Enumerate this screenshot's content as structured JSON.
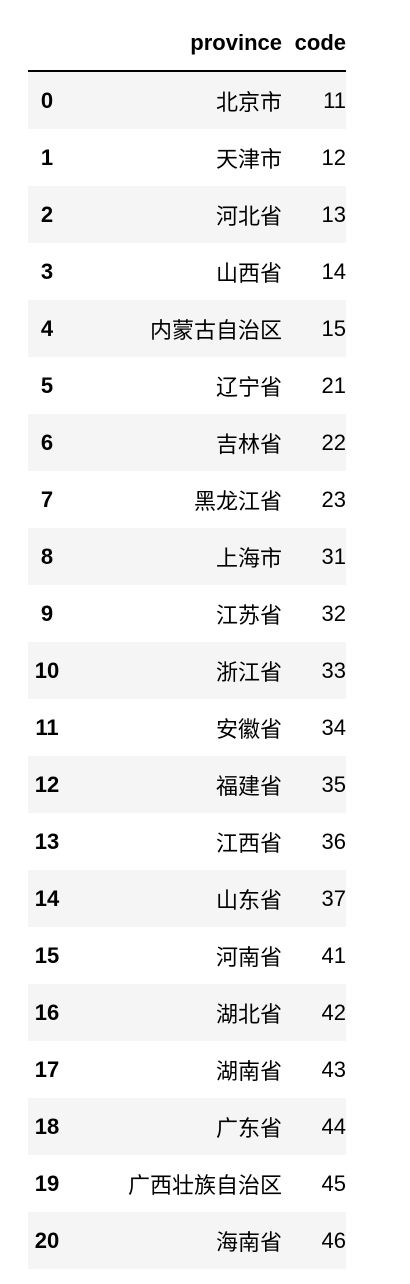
{
  "table": {
    "columns": {
      "index": "",
      "province": "province",
      "code": "code"
    },
    "rows": [
      {
        "index": "0",
        "province": "北京市",
        "code": "11"
      },
      {
        "index": "1",
        "province": "天津市",
        "code": "12"
      },
      {
        "index": "2",
        "province": "河北省",
        "code": "13"
      },
      {
        "index": "3",
        "province": "山西省",
        "code": "14"
      },
      {
        "index": "4",
        "province": "内蒙古自治区",
        "code": "15"
      },
      {
        "index": "5",
        "province": "辽宁省",
        "code": "21"
      },
      {
        "index": "6",
        "province": "吉林省",
        "code": "22"
      },
      {
        "index": "7",
        "province": "黑龙江省",
        "code": "23"
      },
      {
        "index": "8",
        "province": "上海市",
        "code": "31"
      },
      {
        "index": "9",
        "province": "江苏省",
        "code": "32"
      },
      {
        "index": "10",
        "province": "浙江省",
        "code": "33"
      },
      {
        "index": "11",
        "province": "安徽省",
        "code": "34"
      },
      {
        "index": "12",
        "province": "福建省",
        "code": "35"
      },
      {
        "index": "13",
        "province": "江西省",
        "code": "36"
      },
      {
        "index": "14",
        "province": "山东省",
        "code": "37"
      },
      {
        "index": "15",
        "province": "河南省",
        "code": "41"
      },
      {
        "index": "16",
        "province": "湖北省",
        "code": "42"
      },
      {
        "index": "17",
        "province": "湖南省",
        "code": "43"
      },
      {
        "index": "18",
        "province": "广东省",
        "code": "44"
      },
      {
        "index": "19",
        "province": "广西壮族自治区",
        "code": "45"
      },
      {
        "index": "20",
        "province": "海南省",
        "code": "46"
      }
    ]
  },
  "colors": {
    "stripe": "#f5f5f5",
    "header_rule": "#000000",
    "text": "#000000"
  }
}
